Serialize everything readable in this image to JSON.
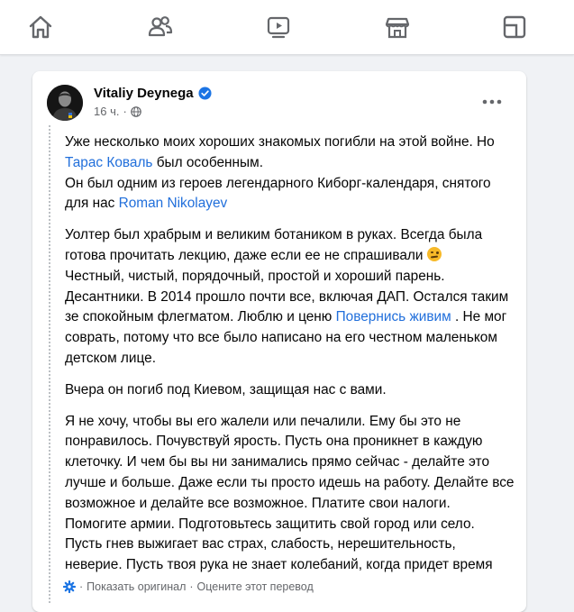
{
  "nav": {
    "items": [
      {
        "name": "home",
        "icon": "home-icon"
      },
      {
        "name": "friends",
        "icon": "friends-icon"
      },
      {
        "name": "watch",
        "icon": "video-icon"
      },
      {
        "name": "marketplace",
        "icon": "marketplace-icon"
      },
      {
        "name": "gaming",
        "icon": "gaming-icon"
      }
    ]
  },
  "post": {
    "author": "Vitaliy Deynega",
    "time": "16 ч.",
    "separator": "·",
    "paragraphs": {
      "p1": {
        "a": "Уже несколько моих хороших знакомых погибли на этой войне. Но ",
        "link1": "Тарас Коваль",
        "b": " был особенным.",
        "c": "Он был одним из героев легендарного Киборг-календаря, снятого для нас ",
        "link2": "Roman Nikolayev"
      },
      "p2": {
        "a": "Уолтер был храбрым и великим ботаником в руках. Всегда была готова прочитать лекцию, даже если ее не спрашивали ",
        "b": "Честный, чистый, порядочный, простой и хороший парень. Десантники. В 2014 прошло почти все, включая ДАП. Остался таким зе спокойным флегматом. Люблю и ценю ",
        "link": "Повернись живим",
        "c": " . Не мог соврать, потому что все было написано на его честном маленьком детском лице."
      },
      "p3": "Вчера он погиб под Киевом, защищая нас с вами.",
      "p4": "Я не хочу, чтобы вы его жалели или печалили. Ему бы это не понравилось. Почувствуй ярость. Пусть она проникнет в каждую клеточку. И чем бы вы ни занимались прямо сейчас - делайте это лучше и больше. Даже если ты просто идешь на работу. Делайте все возможное и делайте все возможное. Платите свои налоги. Помогите армии. Подготовьтесь защитить свой город или село. Пусть гнев выжигает вас страх, слабость, нерешительность, неверие. Пусть твоя рука не знает колебаний, когда придет время"
    },
    "translation": {
      "show_original": "Показать оригинал",
      "separator": "·",
      "rate": "Оцените этот перевод"
    }
  },
  "colors": {
    "link": "#216fdb",
    "icon_gray": "#65676b",
    "verified": "#1b74e4",
    "background": "#f0f2f5"
  }
}
